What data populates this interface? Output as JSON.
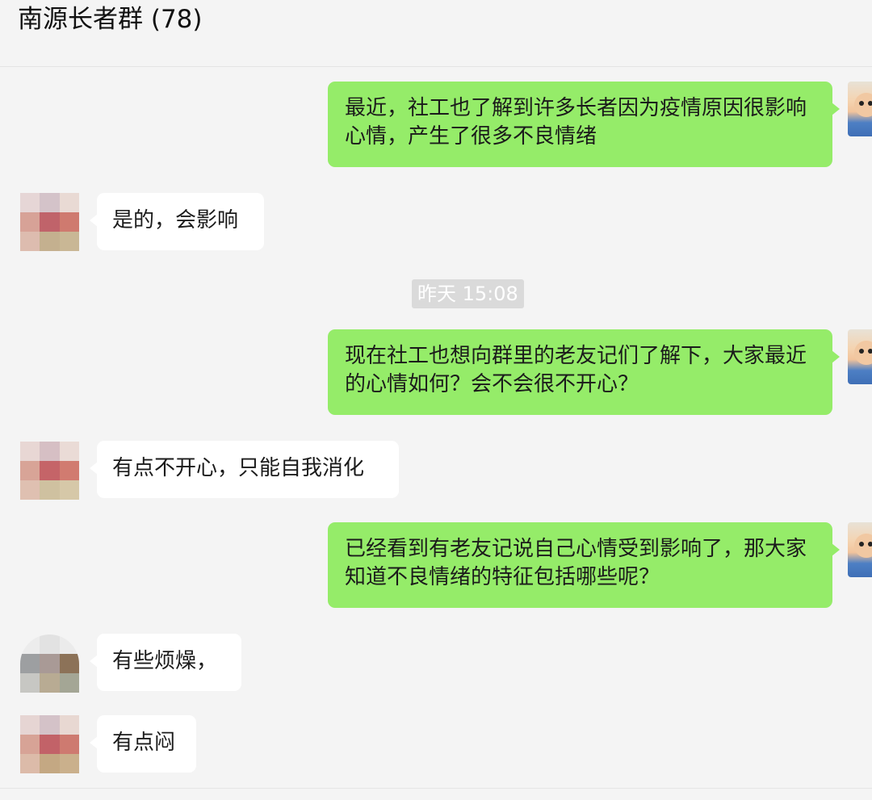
{
  "chat": {
    "title": "南源长者群 (78)"
  },
  "messages": [
    {
      "direction": "out",
      "text": "最近，社工也了解到许多长者因为疫情原因很影响心情，产生了很多不良情绪"
    },
    {
      "direction": "in",
      "text": "是的，会影响"
    },
    {
      "direction": "out",
      "text": "现在社工也想向群里的老友记们了解下，大家最近的心情如何？会不会很不开心？"
    },
    {
      "direction": "in",
      "text": "有点不开心，只能自我消化"
    },
    {
      "direction": "out",
      "text": "已经看到有老友记说自己心情受到影响了，那大家知道不良情绪的特征包括哪些呢？"
    },
    {
      "direction": "in",
      "text": "有些烦燥，"
    },
    {
      "direction": "in",
      "text": "有点闷"
    }
  ],
  "timestamp": "昨天 15:08",
  "colors": {
    "background": "#f4f4f4",
    "outgoing_bubble": "#95ec69",
    "incoming_bubble": "#ffffff",
    "timestamp_bg": "#dadada"
  }
}
